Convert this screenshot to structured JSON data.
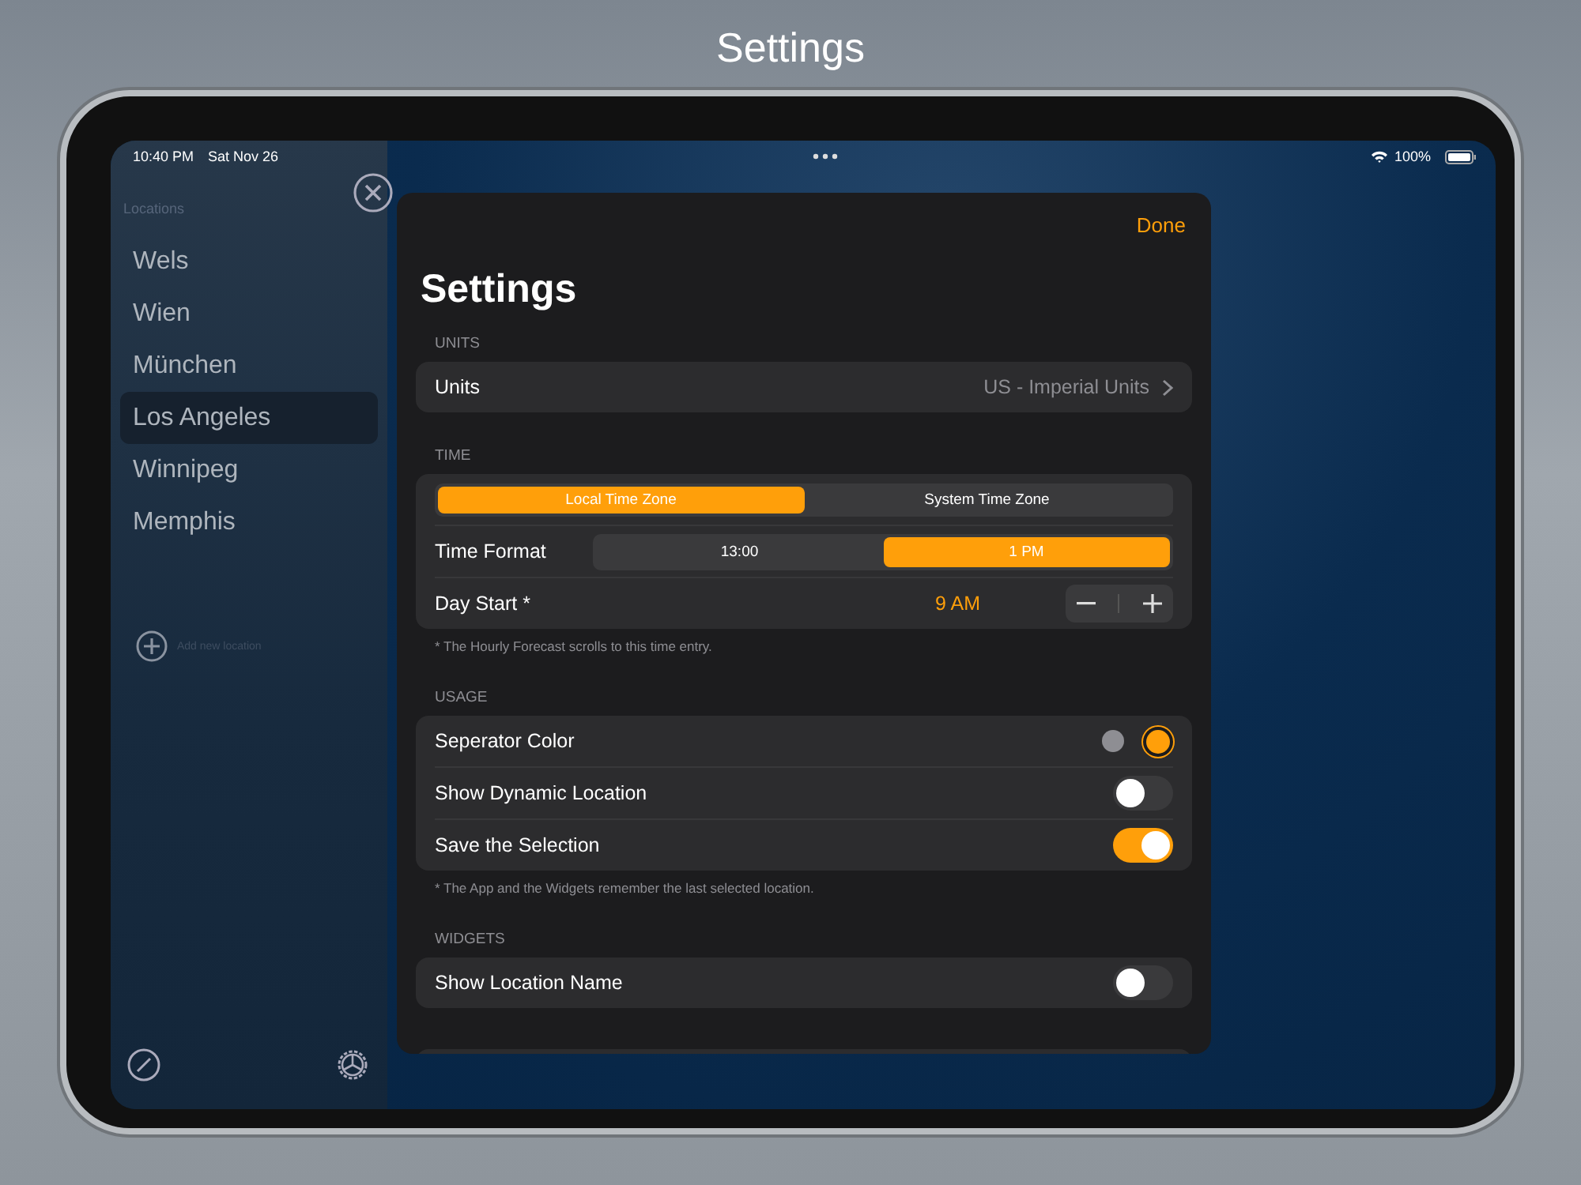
{
  "page_title": "Settings",
  "status_bar": {
    "time": "10:40 PM",
    "date": "Sat Nov 26",
    "battery": "100%"
  },
  "sidebar": {
    "heading": "Locations",
    "items": [
      {
        "label": "Wels",
        "selected": false
      },
      {
        "label": "Wien",
        "selected": false
      },
      {
        "label": "München",
        "selected": false
      },
      {
        "label": "Los Angeles",
        "selected": true
      },
      {
        "label": "Winnipeg",
        "selected": false
      },
      {
        "label": "Memphis",
        "selected": false
      }
    ],
    "add_label": "Add new location"
  },
  "settings": {
    "done": "Done",
    "title": "Settings",
    "sections": [
      {
        "header": "UNITS",
        "rows": [
          {
            "kind": "link",
            "label": "Units",
            "value": "US - Imperial Units"
          }
        ]
      },
      {
        "header": "TIME",
        "rows": [
          {
            "kind": "segmented",
            "options": [
              {
                "label": "Local Time Zone",
                "selected": true
              },
              {
                "label": "System Time Zone",
                "selected": false
              }
            ]
          },
          {
            "kind": "segmented",
            "label": "Time Format",
            "options": [
              {
                "label": "13:00",
                "selected": false
              },
              {
                "label": "1 PM",
                "selected": true
              }
            ]
          },
          {
            "kind": "stepper",
            "label": "Day Start *",
            "value": "9 AM"
          }
        ],
        "footer": "* The Hourly Forecast scrolls to this time entry."
      },
      {
        "header": "USAGE",
        "rows": [
          {
            "kind": "colors",
            "label": "Seperator Color",
            "options": [
              {
                "color": "#8e8e93",
                "selected": false
              },
              {
                "color": "#ff9f0a",
                "selected": true
              }
            ]
          },
          {
            "kind": "toggle",
            "label": "Show Dynamic Location",
            "on": false
          },
          {
            "kind": "toggle",
            "label": "Save the Selection",
            "on": true
          }
        ],
        "footer": "* The App and the Widgets remember the last selected location."
      },
      {
        "header": "WIDGETS",
        "rows": [
          {
            "kind": "toggle",
            "label": "Show Location Name",
            "on": false
          }
        ]
      }
    ]
  }
}
